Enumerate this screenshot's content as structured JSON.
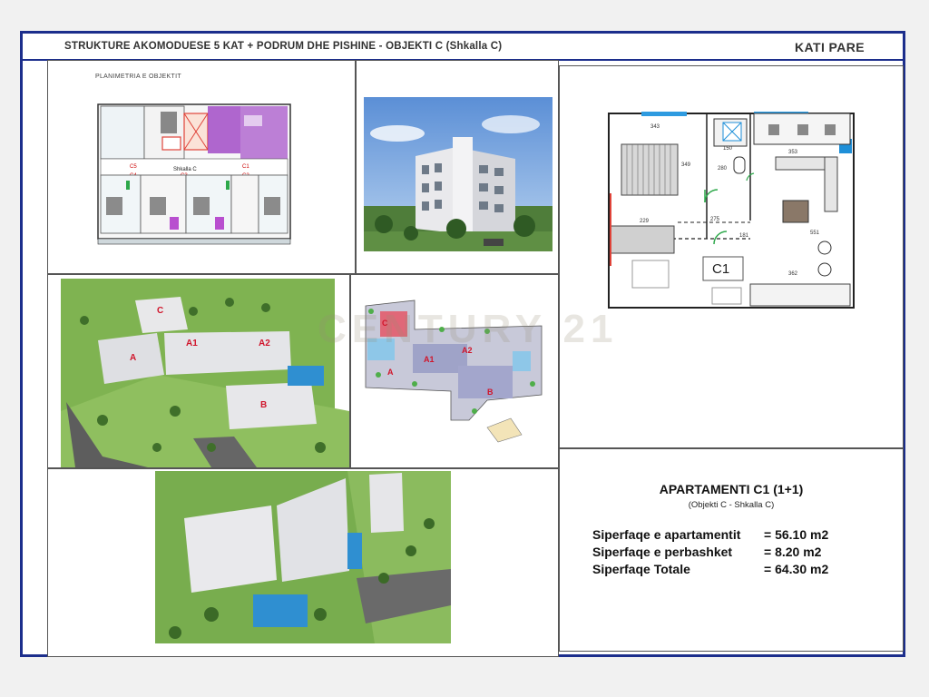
{
  "header": {
    "title": "STRUKTURE AKOMODUESE 5 KAT + PODRUM DHE PISHINE   -  OBJEKTI C (Shkalla C)",
    "floor": "KATI PARE"
  },
  "floor_plan": {
    "caption": "PLANIMETRIA E OBJEKTIT",
    "stair_label": "Shkalla  C",
    "unit_labels": [
      "C1",
      "C2",
      "C3",
      "C4",
      "C5"
    ]
  },
  "unit_plan": {
    "unit_label": "C1",
    "dimensions": [
      "343",
      "349",
      "229",
      "275",
      "362",
      "353",
      "551",
      "150",
      "280",
      "181"
    ]
  },
  "site_plan_3d": {
    "building_labels": [
      "C",
      "A",
      "A1",
      "A2",
      "B"
    ]
  },
  "site_plan_2d": {
    "building_labels": [
      "C",
      "A",
      "A1",
      "A2",
      "B"
    ]
  },
  "watermark": "CENTURY 21",
  "apartment": {
    "title": "APARTAMENTI C1 (1+1)",
    "subtitle": "(Objekti C - Shkalla C)",
    "areas": [
      {
        "label": "Siperfaqe e apartamentit",
        "value": "= 56.10 m2"
      },
      {
        "label": "Siperfaqe e perbashket",
        "value": "=  8.20 m2"
      },
      {
        "label": "Siperfaqe Totale",
        "value": "= 64.30 m2"
      }
    ]
  },
  "colors": {
    "border": "#1c2e8c",
    "highlight_unit": "#a24cc7",
    "stair": "#e0443a",
    "sky": "#6f9fd8",
    "grass": "#7fb351"
  }
}
